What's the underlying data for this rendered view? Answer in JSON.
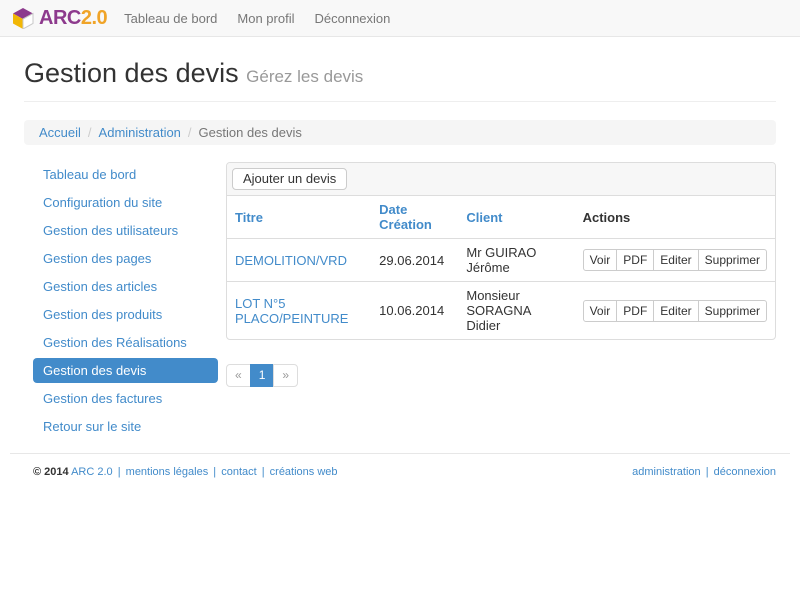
{
  "navbar": {
    "brand": {
      "name_primary": "ARC",
      "name_secondary": "2.0"
    },
    "items": [
      {
        "label": "Tableau de bord"
      },
      {
        "label": "Mon profil"
      },
      {
        "label": "Déconnexion"
      }
    ]
  },
  "page_header": {
    "title": "Gestion des devis",
    "subtitle": "Gérez les devis"
  },
  "breadcrumb": {
    "separator": "/",
    "items": [
      {
        "label": "Accueil"
      },
      {
        "label": "Administration"
      },
      {
        "label": "Gestion des devis"
      }
    ]
  },
  "sidebar": {
    "items": [
      {
        "label": "Tableau de bord",
        "active": false
      },
      {
        "label": "Configuration du site",
        "active": false
      },
      {
        "label": "Gestion des utilisateurs",
        "active": false
      },
      {
        "label": "Gestion des pages",
        "active": false
      },
      {
        "label": "Gestion des articles",
        "active": false
      },
      {
        "label": "Gestion des produits",
        "active": false
      },
      {
        "label": "Gestion des Réalisations",
        "active": false
      },
      {
        "label": "Gestion des devis",
        "active": true
      },
      {
        "label": "Gestion des factures",
        "active": false
      },
      {
        "label": "Retour sur le site",
        "active": false
      }
    ]
  },
  "content": {
    "add_button_label": "Ajouter un devis",
    "table": {
      "headers": [
        {
          "label": "Titre"
        },
        {
          "label": "Date Création"
        },
        {
          "label": "Client"
        },
        {
          "label": "Actions"
        }
      ],
      "rows": [
        {
          "titre": "DEMOLITION/VRD",
          "date_creation": "29.06.2014",
          "client": "Mr GUIRAO Jérôme",
          "actions": [
            "Voir",
            "PDF",
            "Editer",
            "Supprimer"
          ]
        },
        {
          "titre": "LOT N°5 PLACO/PEINTURE",
          "date_creation": "10.06.2014",
          "client": "Monsieur SORAGNA Didier",
          "actions": [
            "Voir",
            "PDF",
            "Editer",
            "Supprimer"
          ]
        }
      ]
    },
    "pagination": {
      "prev": "«",
      "active_page": "1",
      "next": "»"
    }
  },
  "footer": {
    "copyright": "© 2014",
    "separator": "|",
    "left_links": [
      "ARC 2.0",
      "mentions légales",
      "contact",
      "créations web"
    ],
    "right_links": [
      "administration",
      "déconnexion"
    ]
  },
  "icons": {
    "logo": "cube-icon"
  },
  "colors": {
    "accent": "#428bca",
    "brand_purple": "#8d3a8d",
    "brand_orange": "#f0a428",
    "navbar_bg": "#f8f8f8",
    "breadcrumb_bg": "#f5f5f5",
    "border": "#ddd"
  }
}
